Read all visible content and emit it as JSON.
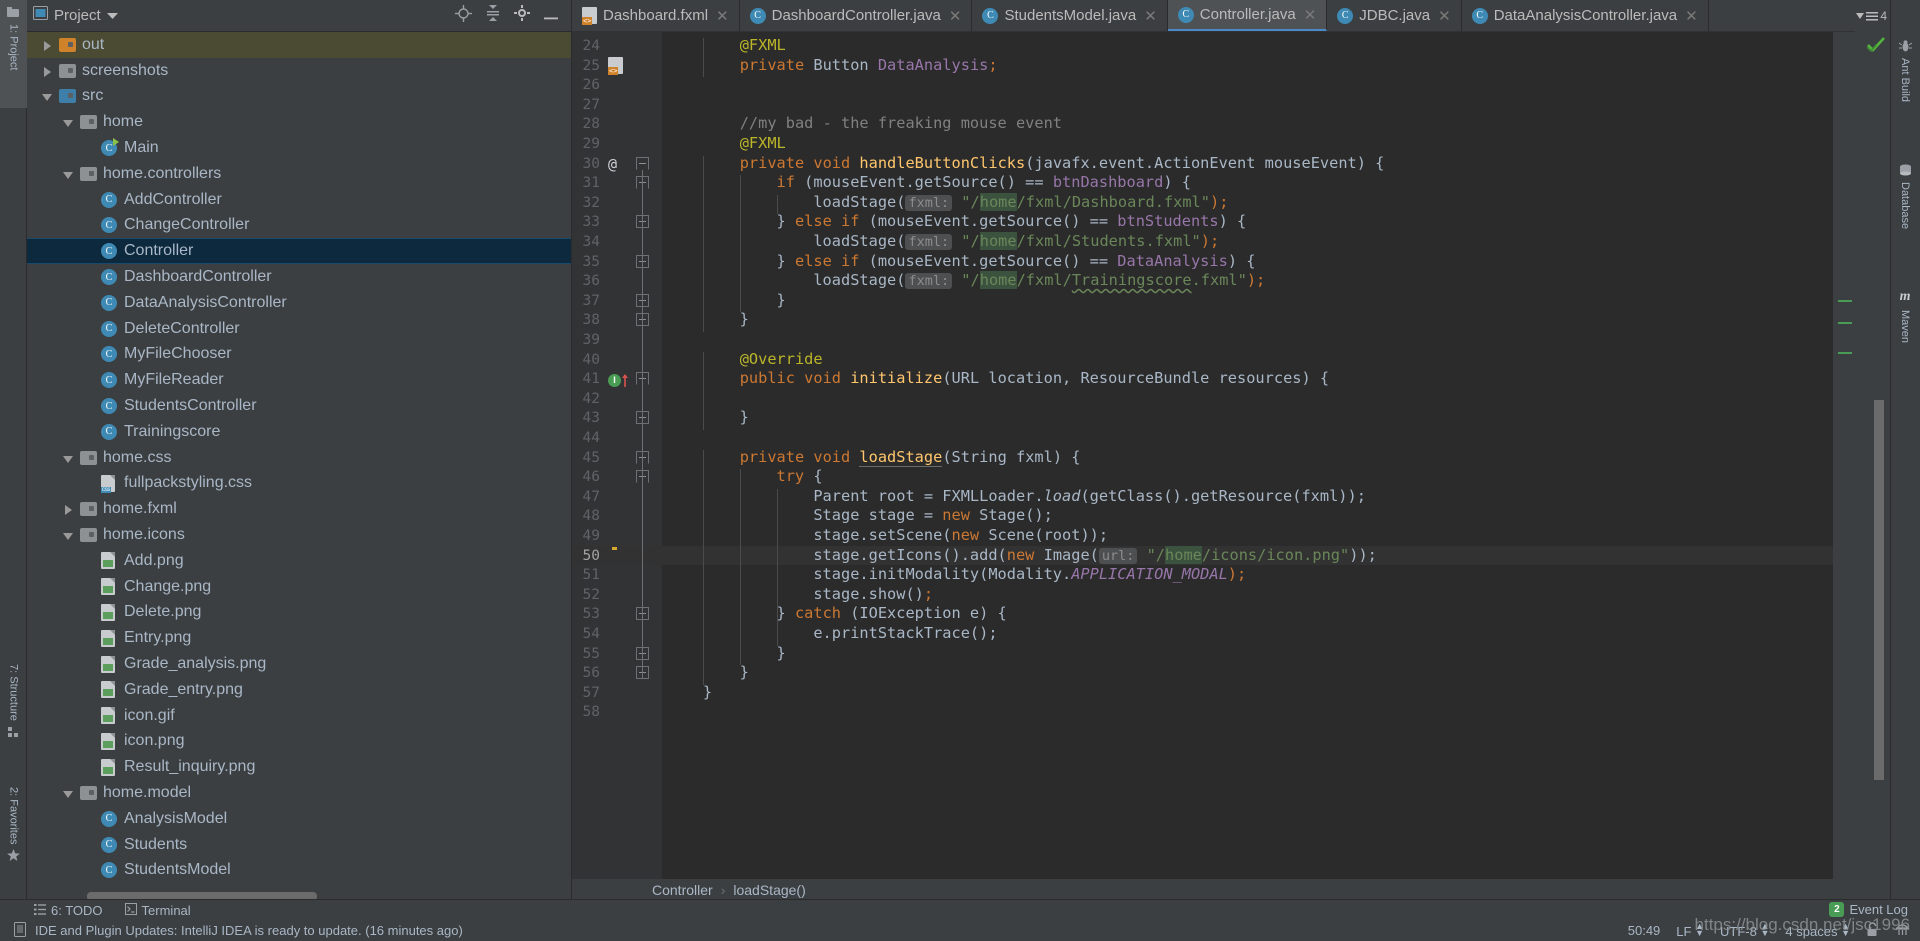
{
  "left_tool_strip": [
    {
      "label": "1: Project",
      "icon": "project-icon",
      "selected": true
    },
    {
      "label": "7: Structure",
      "icon": "structure-icon",
      "selected": false
    },
    {
      "label": "2: Favorites",
      "icon": "star-icon",
      "selected": false
    }
  ],
  "right_tool_strip": [
    {
      "label": "Ant Build",
      "icon": "ant-icon"
    },
    {
      "label": "Database",
      "icon": "database-icon"
    },
    {
      "label": "Maven",
      "icon": "maven-icon"
    }
  ],
  "project_panel": {
    "title": "Project",
    "dropdown_icon": "chevron-down-icon",
    "header_buttons": [
      {
        "name": "locate-icon"
      },
      {
        "name": "collapse-all-icon"
      },
      {
        "name": "settings-gear-icon"
      },
      {
        "name": "hide-icon"
      }
    ],
    "tree": [
      {
        "label": "out",
        "indent": 1,
        "twist": "closed",
        "icon": "folder-orange",
        "state": "olive"
      },
      {
        "label": "screenshots",
        "indent": 1,
        "twist": "closed",
        "icon": "folder-gray",
        "state": ""
      },
      {
        "label": "src",
        "indent": 1,
        "twist": "open",
        "icon": "folder-blue",
        "state": ""
      },
      {
        "label": "home",
        "indent": 2,
        "twist": "open",
        "icon": "folder-package",
        "state": ""
      },
      {
        "label": "Main",
        "indent": 3,
        "twist": "none",
        "icon": "class-run",
        "state": ""
      },
      {
        "label": "home.controllers",
        "indent": 2,
        "twist": "open",
        "icon": "folder-package",
        "state": ""
      },
      {
        "label": "AddController",
        "indent": 3,
        "twist": "none",
        "icon": "class",
        "state": ""
      },
      {
        "label": "ChangeController",
        "indent": 3,
        "twist": "none",
        "icon": "class",
        "state": ""
      },
      {
        "label": "Controller",
        "indent": 3,
        "twist": "none",
        "icon": "class",
        "state": "selected"
      },
      {
        "label": "DashboardController",
        "indent": 3,
        "twist": "none",
        "icon": "class",
        "state": ""
      },
      {
        "label": "DataAnalysisController",
        "indent": 3,
        "twist": "none",
        "icon": "class",
        "state": ""
      },
      {
        "label": "DeleteController",
        "indent": 3,
        "twist": "none",
        "icon": "class",
        "state": ""
      },
      {
        "label": "MyFileChooser",
        "indent": 3,
        "twist": "none",
        "icon": "class",
        "state": ""
      },
      {
        "label": "MyFileReader",
        "indent": 3,
        "twist": "none",
        "icon": "class",
        "state": ""
      },
      {
        "label": "StudentsController",
        "indent": 3,
        "twist": "none",
        "icon": "class",
        "state": ""
      },
      {
        "label": "Trainingscore",
        "indent": 3,
        "twist": "none",
        "icon": "class",
        "state": ""
      },
      {
        "label": "home.css",
        "indent": 2,
        "twist": "open",
        "icon": "folder-package",
        "state": ""
      },
      {
        "label": "fullpackstyling.css",
        "indent": 3,
        "twist": "none",
        "icon": "css-file",
        "state": ""
      },
      {
        "label": "home.fxml",
        "indent": 2,
        "twist": "closed",
        "icon": "folder-package",
        "state": ""
      },
      {
        "label": "home.icons",
        "indent": 2,
        "twist": "open",
        "icon": "folder-package",
        "state": ""
      },
      {
        "label": "Add.png",
        "indent": 3,
        "twist": "none",
        "icon": "image-file",
        "state": ""
      },
      {
        "label": "Change.png",
        "indent": 3,
        "twist": "none",
        "icon": "image-file",
        "state": ""
      },
      {
        "label": "Delete.png",
        "indent": 3,
        "twist": "none",
        "icon": "image-file",
        "state": ""
      },
      {
        "label": "Entry.png",
        "indent": 3,
        "twist": "none",
        "icon": "image-file",
        "state": ""
      },
      {
        "label": "Grade_analysis.png",
        "indent": 3,
        "twist": "none",
        "icon": "image-file",
        "state": ""
      },
      {
        "label": "Grade_entry.png",
        "indent": 3,
        "twist": "none",
        "icon": "image-file",
        "state": ""
      },
      {
        "label": "icon.gif",
        "indent": 3,
        "twist": "none",
        "icon": "image-file",
        "state": ""
      },
      {
        "label": "icon.png",
        "indent": 3,
        "twist": "none",
        "icon": "image-file",
        "state": ""
      },
      {
        "label": "Result_inquiry.png",
        "indent": 3,
        "twist": "none",
        "icon": "image-file",
        "state": ""
      },
      {
        "label": "home.model",
        "indent": 2,
        "twist": "open",
        "icon": "folder-package",
        "state": ""
      },
      {
        "label": "AnalysisModel",
        "indent": 3,
        "twist": "none",
        "icon": "class",
        "state": ""
      },
      {
        "label": "Students",
        "indent": 3,
        "twist": "none",
        "icon": "class",
        "state": ""
      },
      {
        "label": "StudentsModel",
        "indent": 3,
        "twist": "none",
        "icon": "class",
        "state": ""
      }
    ]
  },
  "editor_tabs": [
    {
      "label": "Dashboard.fxml",
      "icon": "fxml-file-icon",
      "active": false
    },
    {
      "label": "DashboardController.java",
      "icon": "class-icon",
      "active": false
    },
    {
      "label": "StudentsModel.java",
      "icon": "class-icon",
      "active": false
    },
    {
      "label": "Controller.java",
      "icon": "class-icon",
      "active": true
    },
    {
      "label": "JDBC.java",
      "icon": "class-icon",
      "active": false
    },
    {
      "label": "DataAnalysisController.java",
      "icon": "class-icon",
      "active": false
    }
  ],
  "tab_overflow_count": "4",
  "editor": {
    "first_line": 24,
    "current_line": 50,
    "lines": [
      {
        "n": 24,
        "indent": 2,
        "tokens": [
          {
            "t": "@FXML",
            "c": "ann"
          }
        ]
      },
      {
        "n": 25,
        "indent": 2,
        "tokens": [
          {
            "t": "private ",
            "c": "k"
          },
          {
            "t": "Button ",
            "c": ""
          },
          {
            "t": "DataAnalysis",
            "c": "fld"
          },
          {
            "t": ";",
            "c": "sem"
          }
        ]
      },
      {
        "n": 26,
        "indent": 0,
        "tokens": []
      },
      {
        "n": 27,
        "indent": 0,
        "tokens": []
      },
      {
        "n": 28,
        "indent": 2,
        "tokens": [
          {
            "t": "//my bad - the freaking mouse event",
            "c": "cmt"
          }
        ]
      },
      {
        "n": 29,
        "indent": 2,
        "tokens": [
          {
            "t": "@FXML",
            "c": "ann"
          }
        ]
      },
      {
        "n": 30,
        "indent": 2,
        "tokens": [
          {
            "t": "private void ",
            "c": "k"
          },
          {
            "t": "handleButtonClicks",
            "c": "mth"
          },
          {
            "t": "(javafx.event.ActionEvent mouseEvent) {",
            "c": ""
          }
        ]
      },
      {
        "n": 31,
        "indent": 3,
        "tokens": [
          {
            "t": "if ",
            "c": "k"
          },
          {
            "t": "(mouseEvent.getSource() == ",
            "c": ""
          },
          {
            "t": "btnDashboard",
            "c": "fld"
          },
          {
            "t": ") {",
            "c": ""
          }
        ]
      },
      {
        "n": 32,
        "indent": 4,
        "tokens": [
          {
            "t": "loadStage(",
            "c": ""
          },
          {
            "t": "fxml:",
            "c": "hint"
          },
          {
            "t": " \"/",
            "c": "str"
          },
          {
            "t": "home",
            "c": "strhl"
          },
          {
            "t": "/fxml/Dashboard.fxml\"",
            "c": "str"
          },
          {
            "t": ");",
            "c": "sem"
          }
        ]
      },
      {
        "n": 33,
        "indent": 3,
        "tokens": [
          {
            "t": "} ",
            "c": ""
          },
          {
            "t": "else if ",
            "c": "k"
          },
          {
            "t": "(mouseEvent.getSource() == ",
            "c": ""
          },
          {
            "t": "btnStudents",
            "c": "fld"
          },
          {
            "t": ") {",
            "c": ""
          }
        ]
      },
      {
        "n": 34,
        "indent": 4,
        "tokens": [
          {
            "t": "loadStage(",
            "c": ""
          },
          {
            "t": "fxml:",
            "c": "hint"
          },
          {
            "t": " \"/",
            "c": "str"
          },
          {
            "t": "home",
            "c": "strhl"
          },
          {
            "t": "/fxml/Students.fxml\"",
            "c": "str"
          },
          {
            "t": ");",
            "c": "sem"
          }
        ]
      },
      {
        "n": 35,
        "indent": 3,
        "tokens": [
          {
            "t": "} ",
            "c": ""
          },
          {
            "t": "else if ",
            "c": "k"
          },
          {
            "t": "(mouseEvent.getSource() == ",
            "c": ""
          },
          {
            "t": "DataAnalysis",
            "c": "fld"
          },
          {
            "t": ") {",
            "c": ""
          }
        ]
      },
      {
        "n": 36,
        "indent": 4,
        "tokens": [
          {
            "t": "loadStage(",
            "c": ""
          },
          {
            "t": "fxml:",
            "c": "hint"
          },
          {
            "t": " \"/",
            "c": "str"
          },
          {
            "t": "home",
            "c": "strhl"
          },
          {
            "t": "/fxml/",
            "c": "str"
          },
          {
            "t": "Trainingscore",
            "c": "strwavy"
          },
          {
            "t": ".fxml\"",
            "c": "str"
          },
          {
            "t": ");",
            "c": "sem"
          }
        ]
      },
      {
        "n": 37,
        "indent": 3,
        "tokens": [
          {
            "t": "}",
            "c": ""
          }
        ]
      },
      {
        "n": 38,
        "indent": 2,
        "tokens": [
          {
            "t": "}",
            "c": ""
          }
        ]
      },
      {
        "n": 39,
        "indent": 0,
        "tokens": []
      },
      {
        "n": 40,
        "indent": 2,
        "tokens": [
          {
            "t": "@Override",
            "c": "ann"
          }
        ]
      },
      {
        "n": 41,
        "indent": 2,
        "tokens": [
          {
            "t": "public void ",
            "c": "k"
          },
          {
            "t": "initialize",
            "c": "mth"
          },
          {
            "t": "(URL location, ResourceBundle resources) {",
            "c": ""
          }
        ]
      },
      {
        "n": 42,
        "indent": 0,
        "tokens": []
      },
      {
        "n": 43,
        "indent": 2,
        "tokens": [
          {
            "t": "}",
            "c": ""
          }
        ]
      },
      {
        "n": 44,
        "indent": 0,
        "tokens": []
      },
      {
        "n": 45,
        "indent": 2,
        "tokens": [
          {
            "t": "private void ",
            "c": "k"
          },
          {
            "t": "loadStage",
            "c": "mthul"
          },
          {
            "t": "(String fxml) {",
            "c": ""
          }
        ]
      },
      {
        "n": 46,
        "indent": 3,
        "tokens": [
          {
            "t": "try ",
            "c": "k"
          },
          {
            "t": "{",
            "c": ""
          }
        ]
      },
      {
        "n": 47,
        "indent": 4,
        "tokens": [
          {
            "t": "Parent root = FXMLLoader.",
            "c": ""
          },
          {
            "t": "load",
            "c": "ital"
          },
          {
            "t": "(getClass().getResource(fxml));",
            "c": ""
          }
        ]
      },
      {
        "n": 48,
        "indent": 4,
        "tokens": [
          {
            "t": "Stage stage = ",
            "c": ""
          },
          {
            "t": "new ",
            "c": "k"
          },
          {
            "t": "Stage();",
            "c": ""
          }
        ]
      },
      {
        "n": 49,
        "indent": 4,
        "tokens": [
          {
            "t": "stage.setScene(",
            "c": ""
          },
          {
            "t": "new ",
            "c": "k"
          },
          {
            "t": "Scene(root));",
            "c": ""
          }
        ]
      },
      {
        "n": 50,
        "indent": 4,
        "tokens": [
          {
            "t": "stage.getIcons().add(",
            "c": ""
          },
          {
            "t": "new ",
            "c": "k"
          },
          {
            "t": "Image(",
            "c": ""
          },
          {
            "t": "url:",
            "c": "hint"
          },
          {
            "t": " \"/",
            "c": "str"
          },
          {
            "t": "home",
            "c": "strhl"
          },
          {
            "t": "/icons/icon.png\"",
            "c": "str"
          },
          {
            "t": "));",
            "c": ""
          }
        ]
      },
      {
        "n": 51,
        "indent": 4,
        "tokens": [
          {
            "t": "stage.initModality(Modality.",
            "c": ""
          },
          {
            "t": "APPLICATION_MODAL",
            "c": "fldital"
          },
          {
            "t": ");",
            "c": "sem"
          }
        ]
      },
      {
        "n": 52,
        "indent": 4,
        "tokens": [
          {
            "t": "stage.show()",
            "c": ""
          },
          {
            "t": ";",
            "c": "sem"
          }
        ]
      },
      {
        "n": 53,
        "indent": 3,
        "tokens": [
          {
            "t": "} ",
            "c": ""
          },
          {
            "t": "catch ",
            "c": "k"
          },
          {
            "t": "(IOException e) {",
            "c": ""
          }
        ]
      },
      {
        "n": 54,
        "indent": 4,
        "tokens": [
          {
            "t": "e.printStackTrace();",
            "c": ""
          }
        ]
      },
      {
        "n": 55,
        "indent": 3,
        "tokens": [
          {
            "t": "}",
            "c": ""
          }
        ]
      },
      {
        "n": 56,
        "indent": 2,
        "tokens": [
          {
            "t": "}",
            "c": ""
          }
        ]
      },
      {
        "n": 57,
        "indent": 1,
        "tokens": [
          {
            "t": "}",
            "c": ""
          }
        ]
      },
      {
        "n": 58,
        "indent": 0,
        "tokens": []
      }
    ]
  },
  "breadcrumb": {
    "class": "Controller",
    "separator": "›",
    "method": "loadStage()"
  },
  "bottom_tabs": [
    {
      "label": "6: TODO",
      "prefix": "6",
      "icon": "todo-icon"
    },
    {
      "label": "Terminal",
      "prefix": "",
      "icon": "terminal-icon"
    }
  ],
  "status_bar": {
    "message": "IDE and Plugin Updates: IntelliJ IDEA is ready to update. (16 minutes ago)",
    "message_icon": "notification-icon",
    "caret_position": "50:49",
    "line_separator": "LF",
    "encoding": "UTF-8",
    "indent": "4 spaces",
    "lock_icon": "unlocked-icon",
    "inspector_icon": "hector-icon"
  },
  "event_log": {
    "label": "Event Log",
    "badge": "2"
  },
  "watermark": "https://blog.csdn.net/jsc1996",
  "inspection_status": "ok-checkmark",
  "colors": {
    "panel_bg": "#3c3f41",
    "editor_bg": "#2b2b2b",
    "gutter_bg": "#313335",
    "selection_blue": "#0d293e",
    "accent_blue": "#4a88c7",
    "keyword_orange": "#cc7832",
    "string_green": "#6a8759",
    "annotation_yellow": "#bbb529",
    "field_purple": "#9876aa",
    "method_gold": "#ffc66d",
    "comment_gray": "#808080",
    "text": "#a9b7c6"
  }
}
